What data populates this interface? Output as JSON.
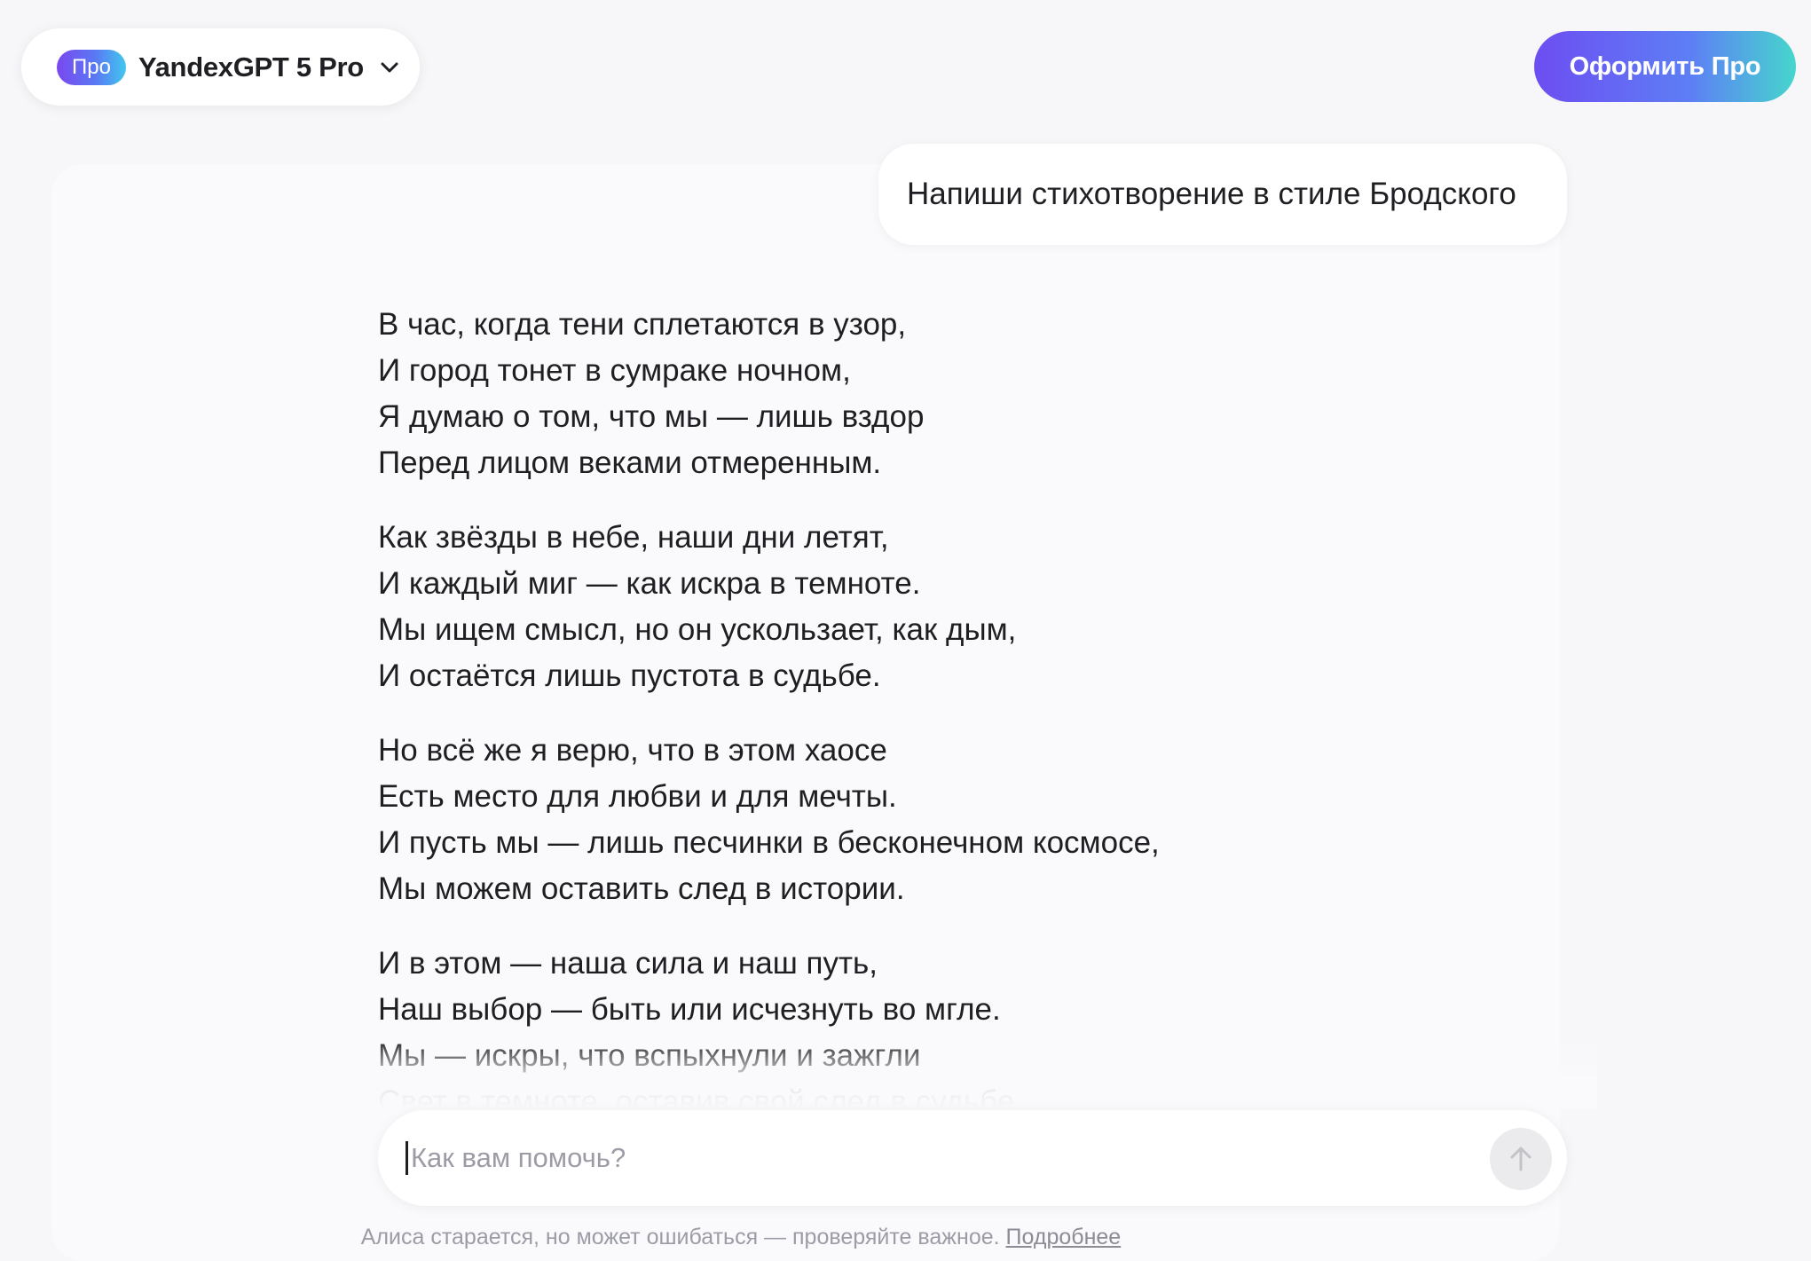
{
  "header": {
    "model_badge": "Про",
    "model_name": "YandexGPT 5 Pro",
    "upgrade_label": "Оформить Про"
  },
  "conversation": {
    "user_message": "Напиши стихотворение в стиле Бродского",
    "assistant_stanzas": [
      [
        "В час, когда тени сплетаются в узор,",
        "И город тонет в сумраке ночном,",
        "Я думаю о том, что мы — лишь вздор",
        "Перед лицом веками отмеренным."
      ],
      [
        "Как звёзды в небе, наши дни летят,",
        "И каждый миг — как искра в темноте.",
        "Мы ищем смысл, но он ускользает, как дым,",
        "И остаётся лишь пустота в судьбе."
      ],
      [
        "Но всё же я верю, что в этом хаосе",
        "Есть место для любви и для мечты.",
        "И пусть мы — лишь песчинки в бесконечном космосе,",
        "Мы можем оставить след в истории."
      ],
      [
        "И в этом — наша сила и наш путь,",
        "Наш выбор — быть или исчезнуть во мгле.",
        "Мы — искры, что вспыхнули и зажгли",
        "Свет в темноте, оставив свой след в судьбе."
      ]
    ]
  },
  "composer": {
    "placeholder": "Как вам помочь?",
    "value": ""
  },
  "footer": {
    "disclaimer": "Алиса старается, но может ошибаться — проверяйте важное.",
    "link_label": "Подробнее"
  },
  "icons": {
    "model_chevron": "chevron-down-icon",
    "send": "arrow-up-icon"
  },
  "colors": {
    "accent_gradient_start": "#6d4df2",
    "accent_gradient_end": "#46d6cd",
    "text": "#1f1f23",
    "muted": "#9c9ca6"
  }
}
